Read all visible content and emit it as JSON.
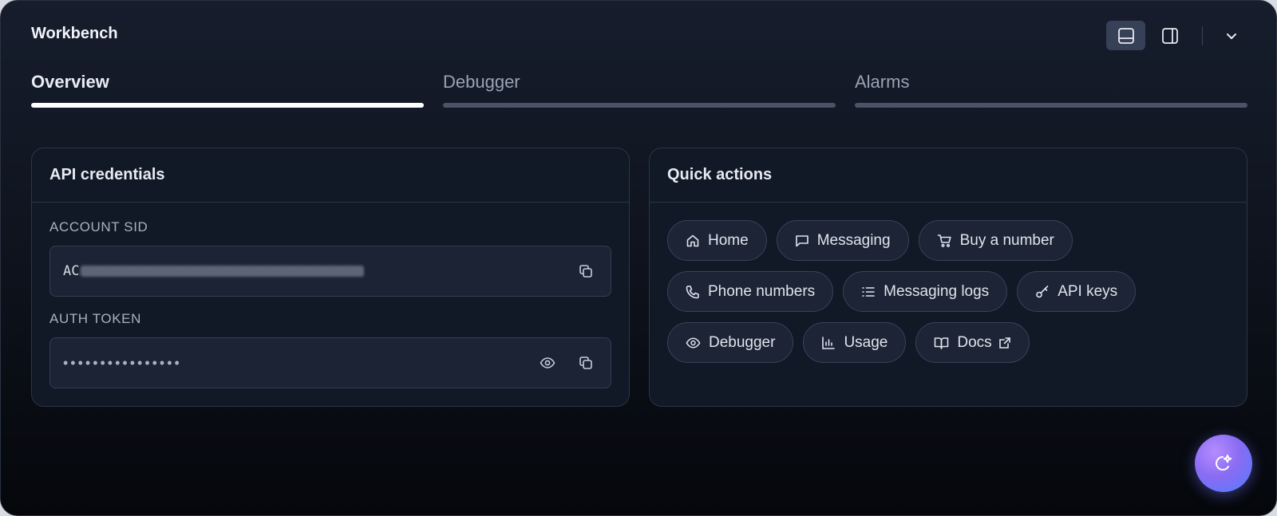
{
  "window": {
    "title": "Workbench"
  },
  "tabs": [
    {
      "label": "Overview",
      "active": true
    },
    {
      "label": "Debugger",
      "active": false
    },
    {
      "label": "Alarms",
      "active": false
    }
  ],
  "credentials": {
    "title": "API credentials",
    "account_sid": {
      "label": "ACCOUNT SID",
      "value_prefix": "AC"
    },
    "auth_token": {
      "label": "AUTH TOKEN",
      "value": "••••••••••••••••"
    }
  },
  "quick_actions": {
    "title": "Quick actions",
    "items": [
      {
        "label": "Home",
        "icon": "home-icon"
      },
      {
        "label": "Messaging",
        "icon": "chat-icon"
      },
      {
        "label": "Buy a number",
        "icon": "cart-icon"
      },
      {
        "label": "Phone numbers",
        "icon": "phone-icon"
      },
      {
        "label": "Messaging logs",
        "icon": "list-icon"
      },
      {
        "label": "API keys",
        "icon": "key-icon"
      },
      {
        "label": "Debugger",
        "icon": "eye-icon"
      },
      {
        "label": "Usage",
        "icon": "chart-icon"
      },
      {
        "label": "Docs",
        "icon": "book-icon"
      }
    ]
  },
  "colors": {
    "accent_gradient_start": "#b58cff",
    "accent_gradient_end": "#4f7cff",
    "background": "#0f141f"
  }
}
